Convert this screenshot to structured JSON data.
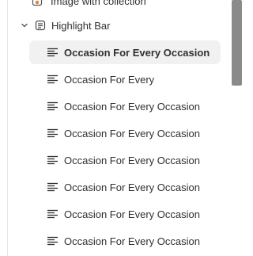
{
  "tree": {
    "top_item": {
      "label": "Image with collection",
      "icon": "image-collection-icon"
    },
    "section": {
      "label": "Highlight Bar",
      "icon": "section-icon",
      "expanded": true
    },
    "items": [
      {
        "label": "Occasion For Every Occasion",
        "icon": "text-icon",
        "selected": true
      },
      {
        "label": "Occasion For Every",
        "icon": "text-icon",
        "selected": false
      },
      {
        "label": "Occasion For Every Occasion",
        "icon": "text-icon",
        "selected": false
      },
      {
        "label": "Occasion For Every Occasion",
        "icon": "text-icon",
        "selected": false
      },
      {
        "label": "Occasion For Every Occasion",
        "icon": "text-icon",
        "selected": false
      },
      {
        "label": "Occasion For Every Occasion",
        "icon": "text-icon",
        "selected": false
      },
      {
        "label": "Occasion For Every Occasion",
        "icon": "text-icon",
        "selected": false
      },
      {
        "label": "Occasion For Every Occasion",
        "icon": "text-icon",
        "selected": false
      }
    ]
  },
  "colors": {
    "selected_bg": "#f1f1f1",
    "text": "#303030",
    "scrollbar_thumb": "#8a8a8a"
  }
}
